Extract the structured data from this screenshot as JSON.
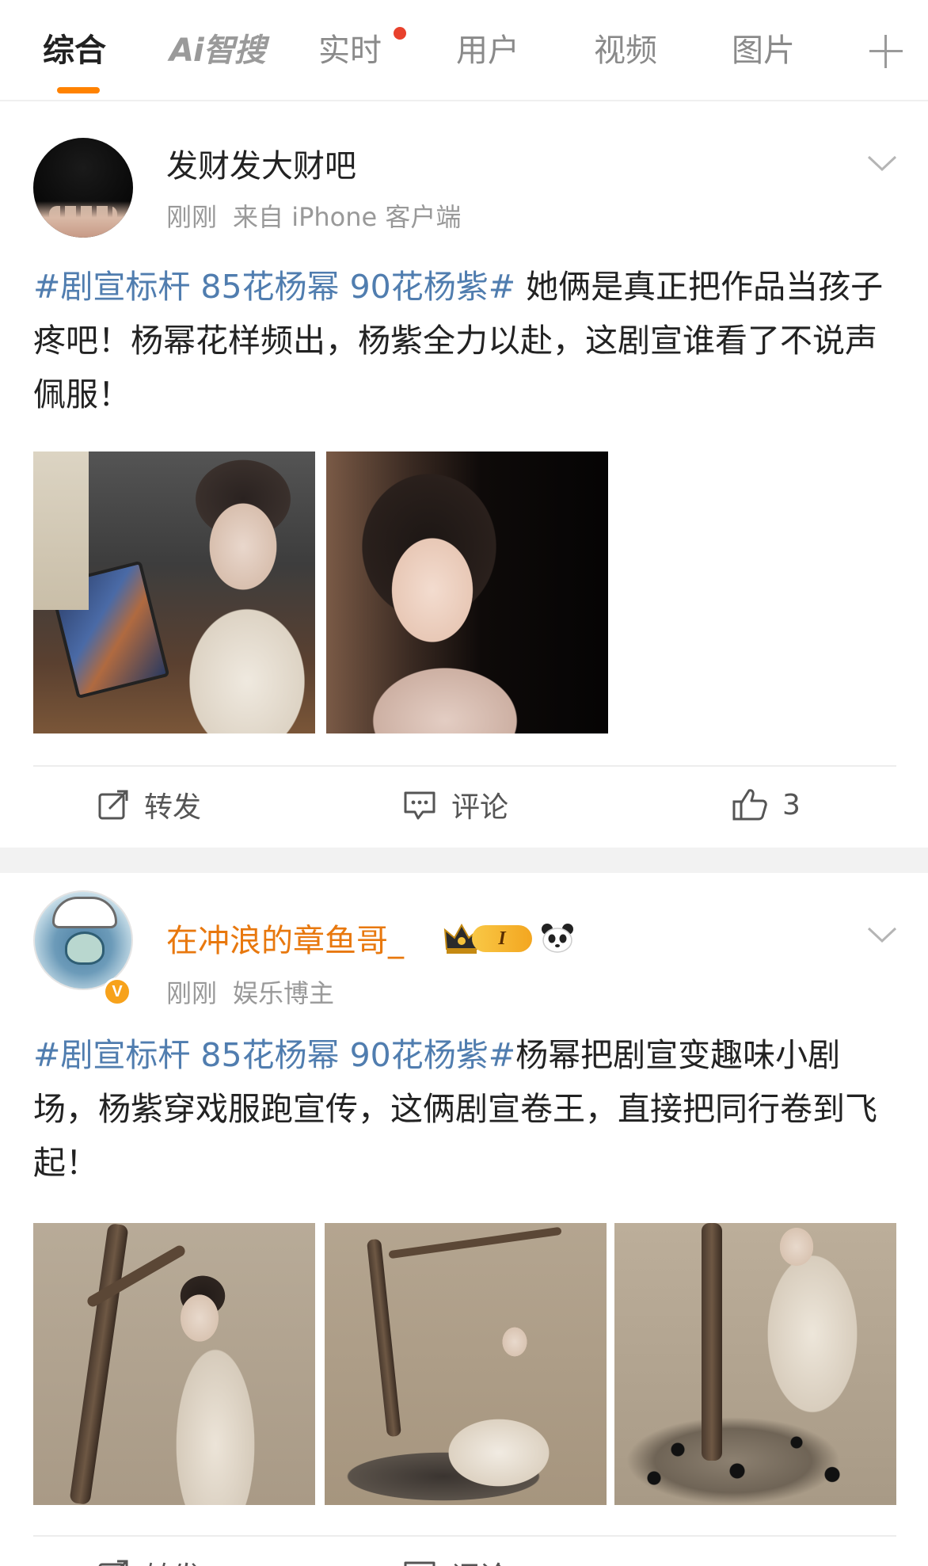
{
  "tabs": [
    {
      "label": "综合",
      "active": true
    },
    {
      "label": "Ai智搜",
      "active": false
    },
    {
      "label": "实时",
      "active": false,
      "has_dot": true
    },
    {
      "label": "用户",
      "active": false
    },
    {
      "label": "视频",
      "active": false
    },
    {
      "label": "图片",
      "active": false
    }
  ],
  "colors": {
    "accent": "#ff8200",
    "hashtag": "#507daf",
    "vip_name": "#e8780e",
    "notice_dot": "#e8412c",
    "secondary_text": "#999999"
  },
  "posts": [
    {
      "username": "发财发大财吧",
      "time": "刚刚",
      "source": "来自 iPhone 客户端",
      "hashtag": "#剧宣标杆 85花杨幂 90花杨紫#",
      "text": " 她俩是真正把作品当孩子疼吧！杨幂花样频出，杨紫全力以赴，这剧宣谁看了不说声佩服！",
      "image_count": 2,
      "actions": {
        "repost": "转发",
        "comment": "评论",
        "like_count": "3"
      }
    },
    {
      "username": "在冲浪的章鱼哥_",
      "level_badge": "I",
      "verified_badge": "V",
      "time": "刚刚",
      "source": "娱乐博主",
      "hashtag": "#剧宣标杆 85花杨幂 90花杨紫#",
      "text": "杨幂把剧宣变趣味小剧场，杨紫穿戏服跑宣传，这俩剧宣卷王，直接把同行卷到飞起！",
      "image_count": 3,
      "actions": {
        "repost": "转发",
        "comment": "评论"
      }
    }
  ]
}
